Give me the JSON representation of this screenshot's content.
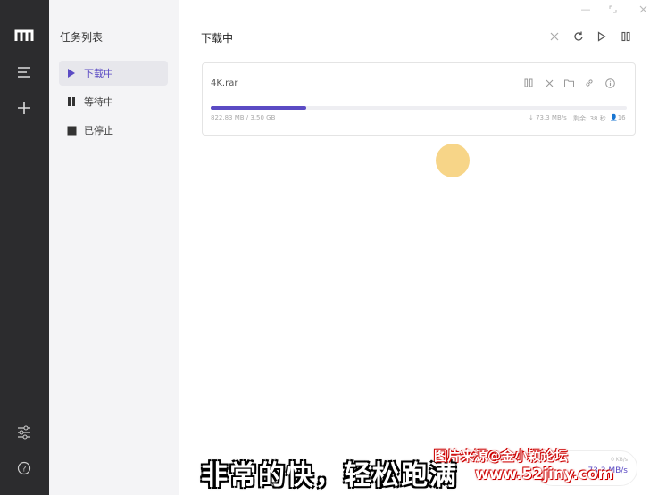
{
  "sidebar": {
    "title": "任务列表",
    "items": [
      {
        "label": "下载中",
        "icon": "play-icon",
        "active": true
      },
      {
        "label": "等待中",
        "icon": "pause-icon",
        "active": false
      },
      {
        "label": "已停止",
        "icon": "stop-icon",
        "active": false
      }
    ]
  },
  "main": {
    "title": "下载中"
  },
  "task": {
    "filename": "4K.rar",
    "downloaded": "822.83 MB / 3.50 GB",
    "progress_percent": 23,
    "speed": "↓ 73.3 MB/s",
    "remaining": "剩余: 38 秒",
    "connections": "16"
  },
  "speedbox": {
    "upload": "0 KB/s",
    "download": "73.3 MB/s"
  },
  "overlay": {
    "subtitle": "非常的快，轻松跑满",
    "watermark_line1": "图片来源@金小颖论坛",
    "watermark_line2": "www.52jiny.com"
  },
  "colors": {
    "accent": "#5b4bc4",
    "rail": "#2c2c2e",
    "sidebar": "#f4f4f6"
  }
}
